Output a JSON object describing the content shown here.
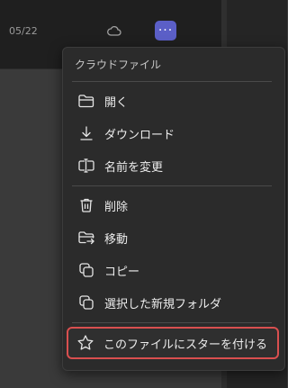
{
  "header": {
    "date": "05/22",
    "cloud_icon": "cloud-icon",
    "more_button_label": "···"
  },
  "menu": {
    "title": "クラウドファイル",
    "items": [
      {
        "label": "開く",
        "icon": "folder-open-icon"
      },
      {
        "label": "ダウンロード",
        "icon": "download-icon"
      },
      {
        "label": "名前を変更",
        "icon": "rename-icon"
      },
      {
        "label": "削除",
        "icon": "trash-icon"
      },
      {
        "label": "移動",
        "icon": "move-icon"
      },
      {
        "label": "コピー",
        "icon": "copy-icon"
      },
      {
        "label": "選択した新規フォルダ",
        "icon": "copy-folder-icon"
      },
      {
        "label": "このファイルにスターを付ける",
        "icon": "star-icon"
      }
    ]
  },
  "colors": {
    "accent": "#5b5fc7",
    "highlight_border": "#d94f4f",
    "menu_bg": "#2b2b2b"
  }
}
